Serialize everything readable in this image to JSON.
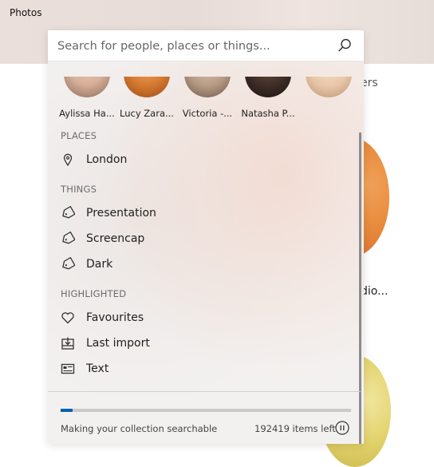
{
  "app": {
    "title": "Photos"
  },
  "background": {
    "partial_label_right": "ers",
    "partial_label_card": "dio..."
  },
  "search": {
    "placeholder": "Search for people, places or things...",
    "value": ""
  },
  "people": [
    {
      "name": "Aylissa Ha...",
      "color": "#d9b09a"
    },
    {
      "name": "Lucy Zara...",
      "color": "#d4782f"
    },
    {
      "name": "Victoria -...",
      "color": "#b69a84"
    },
    {
      "name": "Natasha P...",
      "color": "#3a2a25"
    },
    {
      "name": "",
      "color": "#e8c7a8"
    }
  ],
  "places": {
    "header": "PLACES",
    "items": [
      {
        "label": "London",
        "icon": "location-pin-icon"
      }
    ]
  },
  "things": {
    "header": "THINGS",
    "items": [
      {
        "label": "Presentation",
        "icon": "tag-icon"
      },
      {
        "label": "Screencap",
        "icon": "tag-icon"
      },
      {
        "label": "Dark",
        "icon": "tag-icon"
      }
    ]
  },
  "highlighted": {
    "header": "HIGHLIGHTED",
    "items": [
      {
        "label": "Favourites",
        "icon": "heart-icon"
      },
      {
        "label": "Last import",
        "icon": "import-icon"
      },
      {
        "label": "Text",
        "icon": "text-card-icon"
      }
    ]
  },
  "indexing": {
    "status": "Making your collection searchable",
    "items_left": "192419 items left",
    "progress": 0.04,
    "accent": "#0063b1"
  }
}
